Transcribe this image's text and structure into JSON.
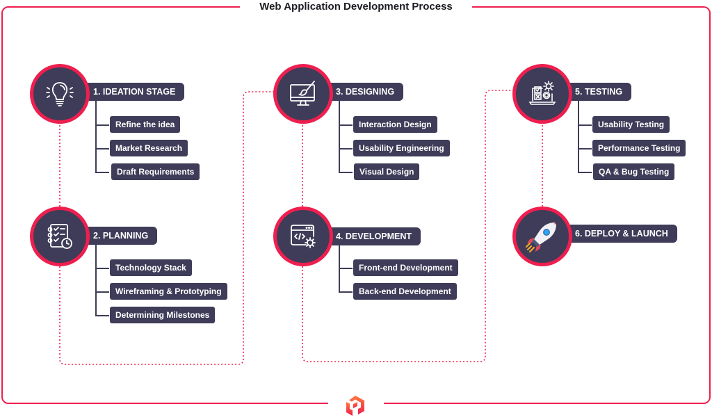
{
  "title": "Web Application Development Process",
  "colors": {
    "accent": "#ee1f4f",
    "node": "#3e3c58",
    "text_light": "#ffffff"
  },
  "stages": [
    {
      "label": "1. IDEATION STAGE",
      "icon": "lightbulb-icon",
      "items": [
        "Refine the idea",
        "Market Research",
        "Draft Requirements"
      ]
    },
    {
      "label": "2. PLANNING",
      "icon": "checklist-clock-icon",
      "items": [
        "Technology Stack",
        "Wireframing & Prototyping",
        "Determining Milestones"
      ]
    },
    {
      "label": "3. DESIGNING",
      "icon": "monitor-brush-icon",
      "items": [
        "Interaction Design",
        "Usability Engineering",
        "Visual Design"
      ]
    },
    {
      "label": "4. DEVELOPMENT",
      "icon": "code-window-gear-icon",
      "items": [
        "Front-end Development",
        "Back-end Development"
      ]
    },
    {
      "label": "5. TESTING",
      "icon": "test-laptop-gears-icon",
      "items": [
        "Usability Testing",
        "Performance Testing",
        "QA & Bug Testing"
      ]
    },
    {
      "label": "6. DEPLOY & LAUNCH",
      "icon": "rocket-icon",
      "items": []
    }
  ]
}
